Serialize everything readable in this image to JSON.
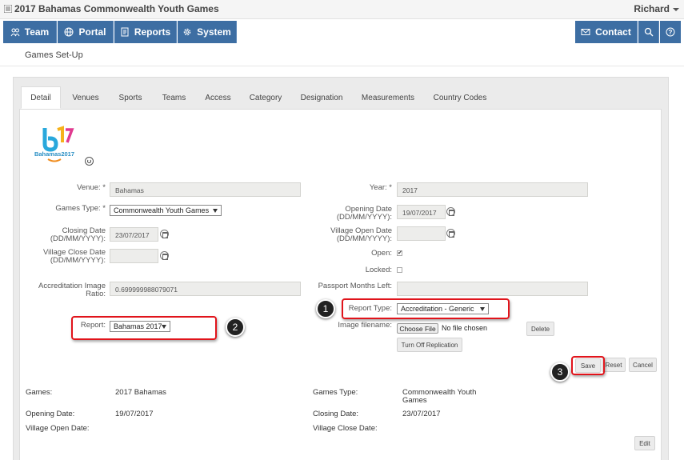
{
  "app": {
    "title": "2017 Bahamas Commonwealth Youth Games",
    "user": "Richard"
  },
  "nav": {
    "team": "Team",
    "portal": "Portal",
    "reports": "Reports",
    "system": "System",
    "contact": "Contact",
    "icons": [
      "team-icon",
      "globe-icon",
      "reports-icon",
      "gear-icon",
      "envelope-icon",
      "search-icon",
      "help-icon"
    ],
    "accent": "#3d6ea3"
  },
  "page": {
    "heading": "Games Set-Up"
  },
  "tabs": [
    "Detail",
    "Venues",
    "Sports",
    "Teams",
    "Access",
    "Category",
    "Designation",
    "Measurements",
    "Country Codes"
  ],
  "logo": {
    "text": "Bahamas2017"
  },
  "form": {
    "venue_label": "Venue: *",
    "venue_value": "Bahamas",
    "year_label": "Year: *",
    "year_value": "2017",
    "games_type_label": "Games Type: *",
    "games_type_value": "Commonwealth Youth Games",
    "opening_label_1": "Opening Date",
    "opening_label_2": "(DD/MM/YYYY):",
    "opening_value": "19/07/2017",
    "closing_label_1": "Closing Date",
    "closing_label_2": "(DD/MM/YYYY):",
    "closing_value": "23/07/2017",
    "village_open_label_1": "Village Open Date",
    "village_open_label_2": "(DD/MM/YYYY):",
    "village_open_value": "",
    "village_close_label_1": "Village Close Date",
    "village_close_label_2": "(DD/MM/YYYY):",
    "village_close_value": "",
    "open_label": "Open:",
    "open_checked": "✔",
    "locked_label": "Locked:",
    "accr_label_1": "Accreditation Image",
    "accr_label_2": "Ratio:",
    "accr_value": "0.699999988079071",
    "passport_label": "Passport Months Left:",
    "passport_value": "",
    "report_type_label": "Report Type:",
    "report_type_value": "Accreditation - Generic",
    "report_label": "Report:",
    "report_value": "Bahamas 2017",
    "image_filename_label": "Image filename:",
    "choose_file": "Choose File",
    "no_file": "No file chosen",
    "delete": "Delete",
    "turn_off_replication": "Turn Off Replication",
    "save": "Save",
    "reset": "Reset",
    "cancel": "Cancel"
  },
  "callouts": [
    "1",
    "2",
    "3"
  ],
  "summary": {
    "games_label": "Games:",
    "games_value": "2017 Bahamas",
    "games_type_label": "Games Type:",
    "games_type_value_1": "Commonwealth Youth",
    "games_type_value_2": "Games",
    "opening_label": "Opening Date:",
    "opening_value": "19/07/2017",
    "closing_label": "Closing Date:",
    "closing_value": "23/07/2017",
    "village_open_label": "Village Open Date:",
    "village_close_label": "Village Close Date:",
    "edit": "Edit"
  }
}
